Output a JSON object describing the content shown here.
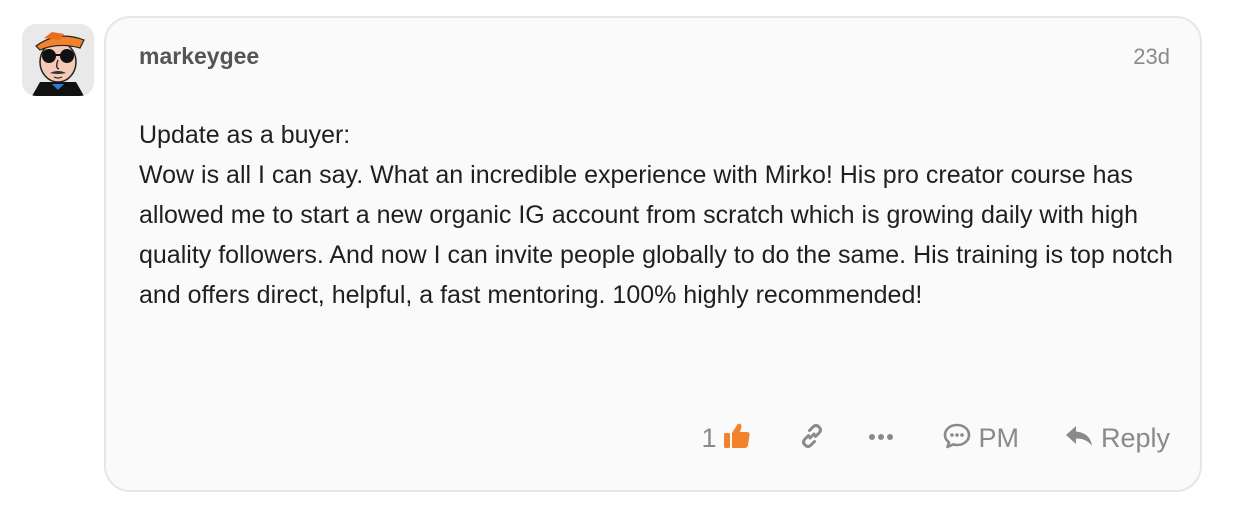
{
  "post": {
    "username": "markeygee",
    "date": "23d",
    "body": [
      "Update as a buyer:",
      "Wow is all I can say. What an incredible experience with Mirko! His pro creator course has allowed me to start a new organic IG account from scratch which is growing daily with high quality followers. And now I can invite people globally to do the same. His training is top notch and offers direct, helpful, a fast mentoring. 100% highly recommended!"
    ],
    "actions": {
      "like_count": "1",
      "pm_label": "PM",
      "reply_label": "Reply"
    },
    "icons": {
      "like": "thumbs-up-icon",
      "link": "link-icon",
      "more": "ellipsis-icon",
      "pm": "speech-bubble-icon",
      "reply": "reply-arrow-icon"
    },
    "colors": {
      "like_accent": "#f2822c",
      "muted": "#8a8a8a",
      "text": "#1f1f1f",
      "card_bg": "#fafafa",
      "card_border": "#e6e6e6"
    }
  }
}
